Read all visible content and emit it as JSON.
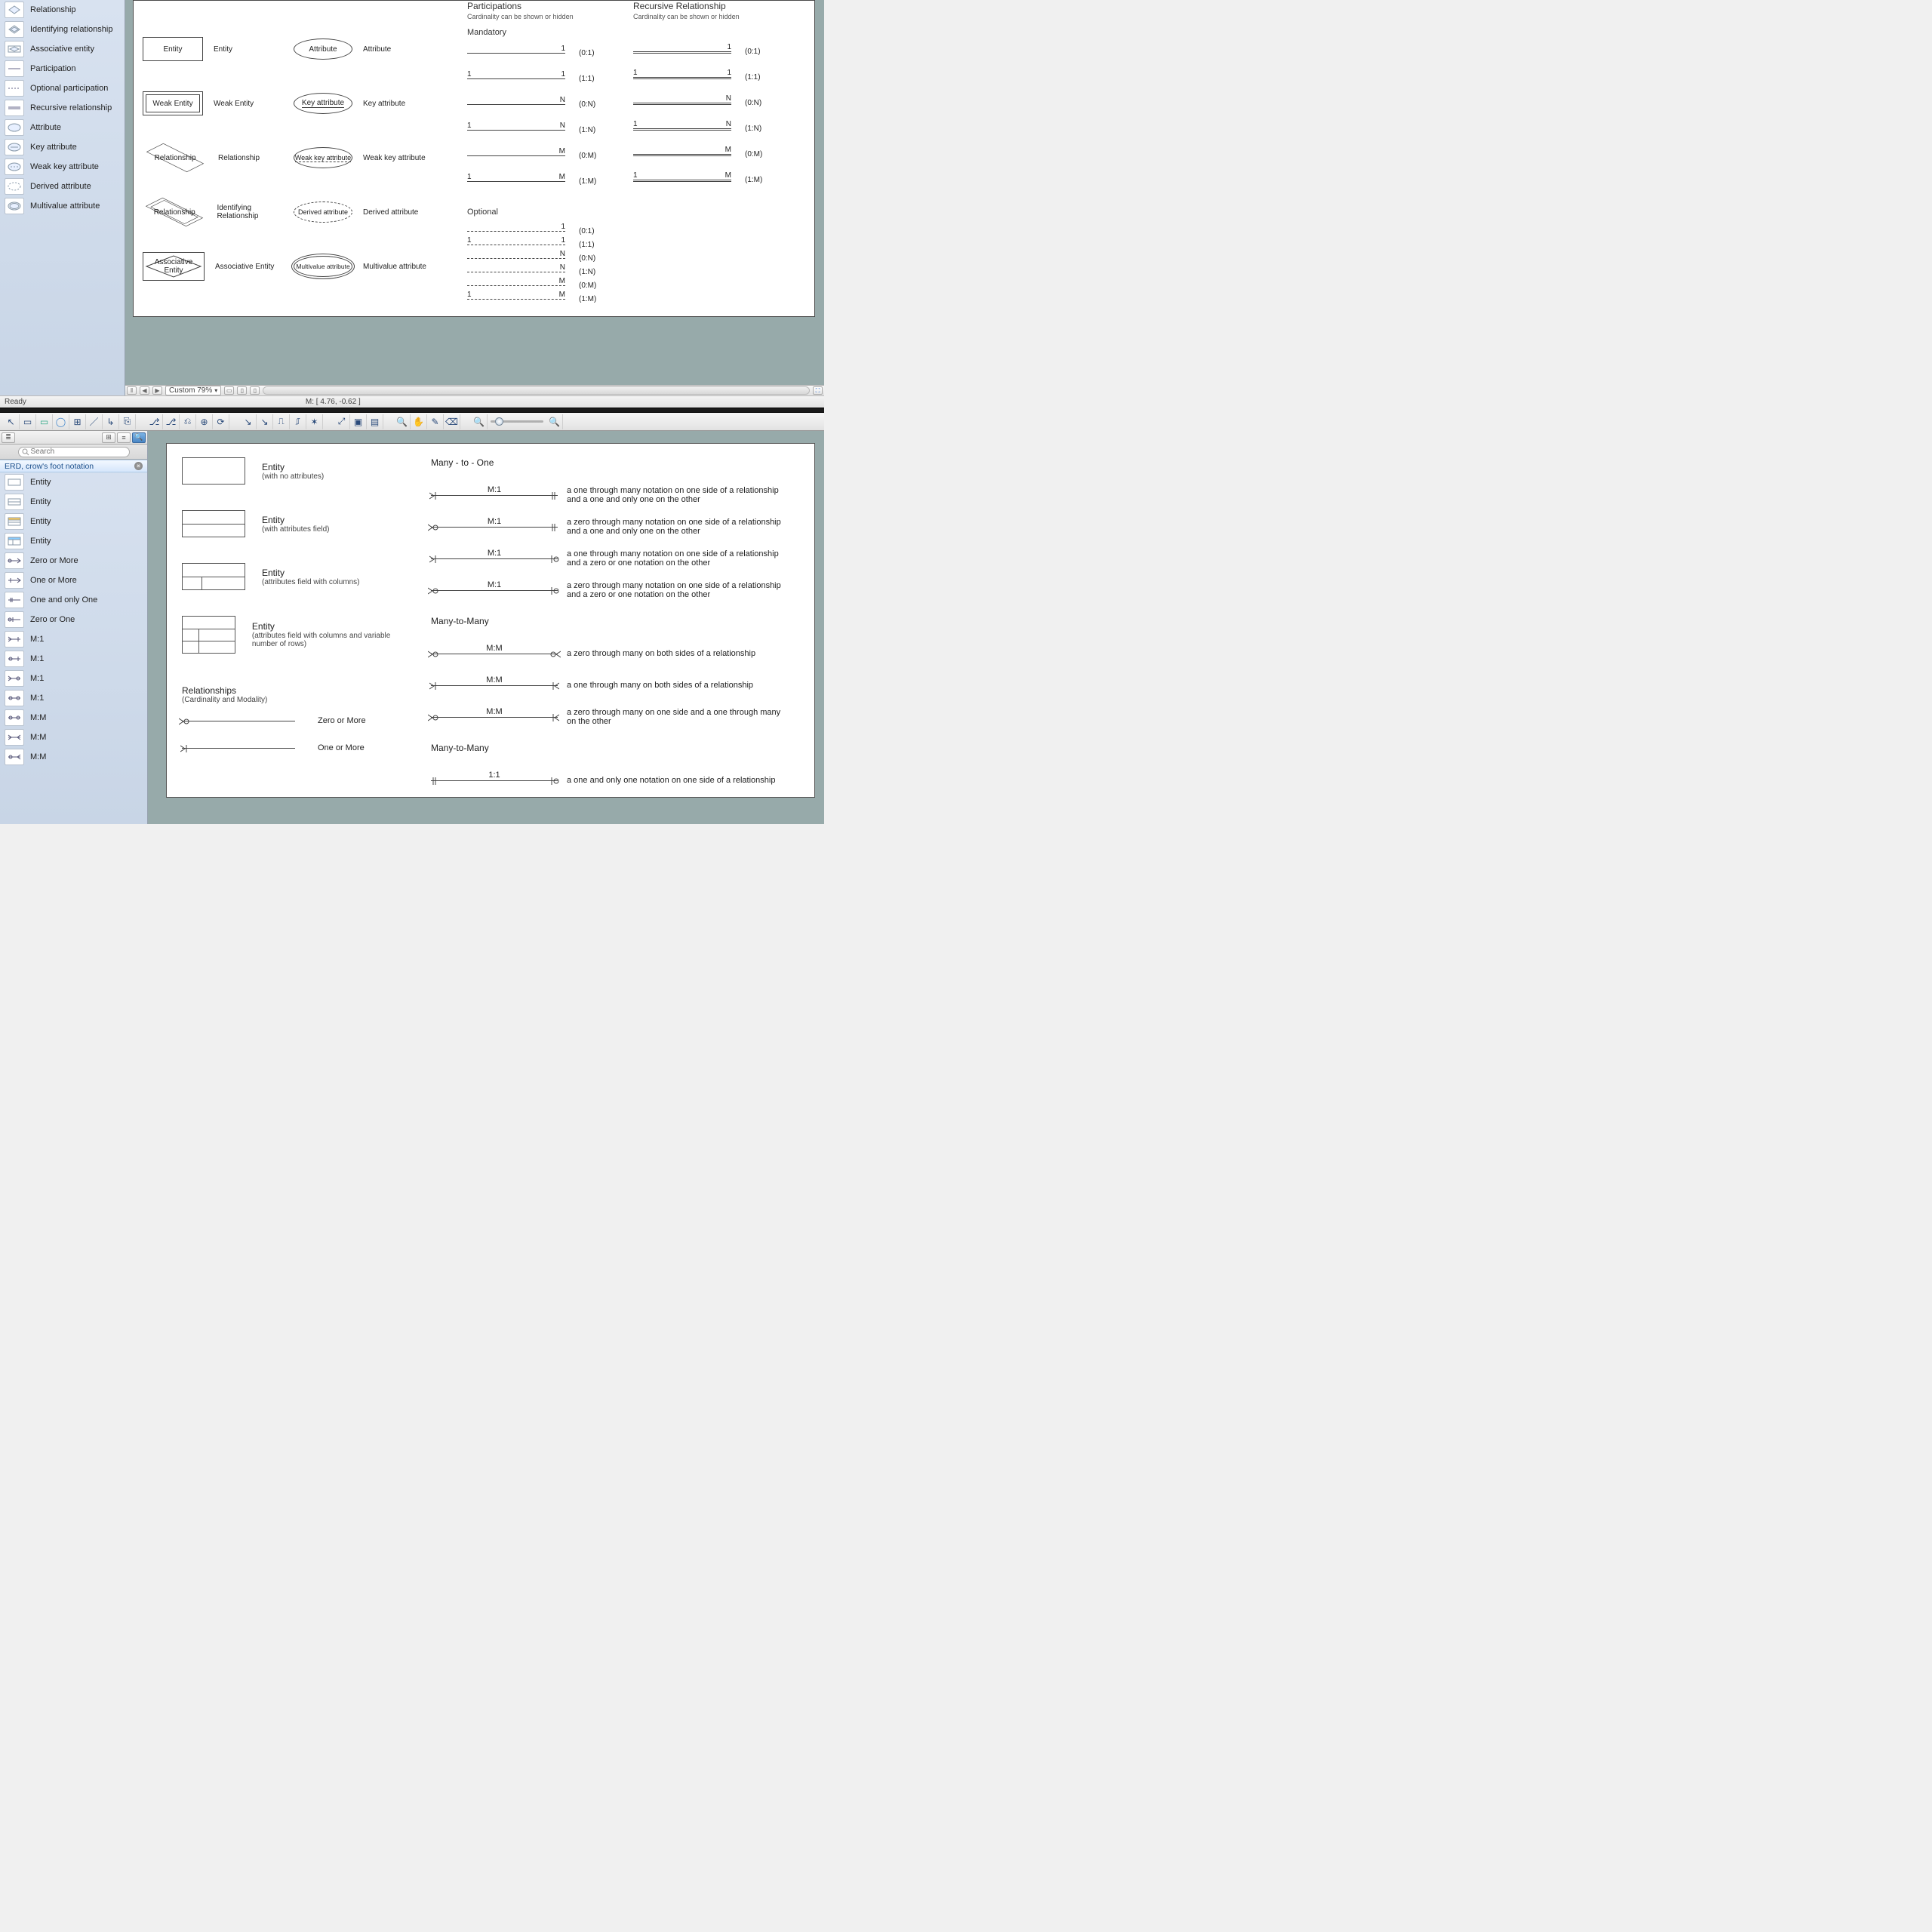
{
  "status": {
    "ready": "Ready",
    "mouse": "M: [ 4.76, -0.62 ]",
    "zoom": "Custom 79%"
  },
  "search_placeholder": "Search",
  "lib_chen": [
    {
      "label": "Relationship"
    },
    {
      "label": "Identifying relationship"
    },
    {
      "label": "Associative entity"
    },
    {
      "label": "Participation"
    },
    {
      "label": "Optional participation"
    },
    {
      "label": "Recursive relationship"
    },
    {
      "label": "Attribute"
    },
    {
      "label": "Key attribute"
    },
    {
      "label": "Weak key attribute"
    },
    {
      "label": "Derived attribute"
    },
    {
      "label": "Multivalue attribute"
    }
  ],
  "chen_canvas": {
    "col1": [
      {
        "shape_label": "Entity",
        "type": "rect",
        "desc": "Entity"
      },
      {
        "shape_label": "Weak Entity",
        "type": "rect-double",
        "desc": "Weak Entity"
      },
      {
        "shape_label": "Relationship",
        "type": "diamond",
        "desc": "Relationship"
      },
      {
        "shape_label": "Relationship",
        "type": "diamond-double",
        "desc": "Identifying Relationship"
      },
      {
        "shape_label": "Associative\nEntity",
        "type": "assoc",
        "desc": "Associative Entity"
      }
    ],
    "col2": [
      {
        "shape_label": "Attribute",
        "type": "oval",
        "desc": "Attribute"
      },
      {
        "shape_label": "Key attribute",
        "type": "oval-under",
        "desc": "Key attribute"
      },
      {
        "shape_label": "Weak key attribute",
        "type": "oval-dash-under",
        "desc": "Weak key attribute"
      },
      {
        "shape_label": "Derived attribute",
        "type": "oval-dashed",
        "desc": "Derived attribute"
      },
      {
        "shape_label": "Multivalue attribute",
        "type": "oval-double",
        "desc": "Multivalue attribute"
      }
    ],
    "part_title": "Participations",
    "part_sub": "Cardinality can be shown or hidden",
    "rec_title": "Recursive Relationship",
    "rec_sub": "Cardinality can be shown or hidden",
    "mand_title": "Mandatory",
    "opt_title": "Optional",
    "mand": [
      {
        "l": "",
        "r": "1",
        "ratio": "(0:1)"
      },
      {
        "l": "1",
        "r": "1",
        "ratio": "(1:1)"
      },
      {
        "l": "",
        "r": "N",
        "ratio": "(0:N)"
      },
      {
        "l": "1",
        "r": "N",
        "ratio": "(1:N)"
      },
      {
        "l": "",
        "r": "M",
        "ratio": "(0:M)"
      },
      {
        "l": "1",
        "r": "M",
        "ratio": "(1:M)"
      }
    ],
    "rec": [
      {
        "l": "",
        "r": "1",
        "ratio": "(0:1)"
      },
      {
        "l": "1",
        "r": "1",
        "ratio": "(1:1)"
      },
      {
        "l": "",
        "r": "N",
        "ratio": "(0:N)"
      },
      {
        "l": "1",
        "r": "N",
        "ratio": "(1:N)"
      },
      {
        "l": "",
        "r": "M",
        "ratio": "(0:M)"
      },
      {
        "l": "1",
        "r": "M",
        "ratio": "(1:M)"
      }
    ],
    "opt": [
      {
        "l": "",
        "r": "1",
        "ratio": "(0:1)"
      },
      {
        "l": "1",
        "r": "1",
        "ratio": "(1:1)"
      },
      {
        "l": "",
        "r": "N",
        "ratio": "(0:N)"
      },
      {
        "l": "",
        "r": "N",
        "ratio": "(1:N)"
      },
      {
        "l": "",
        "r": "M",
        "ratio": "(0:M)"
      },
      {
        "l": "1",
        "r": "M",
        "ratio": "(1:M)"
      }
    ]
  },
  "crow_lib_title": "ERD, crow's foot notation",
  "lib_crow": [
    {
      "label": "Entity"
    },
    {
      "label": "Entity"
    },
    {
      "label": "Entity"
    },
    {
      "label": "Entity"
    },
    {
      "label": "Zero or More"
    },
    {
      "label": "One or More"
    },
    {
      "label": "One and only One"
    },
    {
      "label": "Zero or One"
    },
    {
      "label": "M:1"
    },
    {
      "label": "M:1"
    },
    {
      "label": "M:1"
    },
    {
      "label": "M:1"
    },
    {
      "label": "M:M"
    },
    {
      "label": "M:M"
    },
    {
      "label": "M:M"
    }
  ],
  "crow_canvas": {
    "entities": [
      {
        "name": "Entity",
        "sub": "(with no attributes)",
        "variant": "plain"
      },
      {
        "name": "Entity",
        "sub": "(with attributes field)",
        "variant": "split"
      },
      {
        "name": "Entity",
        "sub": "(attributes field with columns)",
        "variant": "cols"
      },
      {
        "name": "Entity",
        "sub": "(attributes field with columns and variable number of rows)",
        "variant": "rows"
      }
    ],
    "rel_title": "Relationships",
    "rel_sub": "(Cardinality and Modality)",
    "rel_list": [
      {
        "label": "Zero or More",
        "end": "zero-many"
      },
      {
        "label": "One or More",
        "end": "one-many"
      }
    ],
    "sections": [
      {
        "title": "Many - to - One",
        "rows": [
          {
            "tag": "M:1",
            "desc": "a one through many notation on one side of a relationship and a one and only one on the other"
          },
          {
            "tag": "M:1",
            "desc": "a zero through many notation on one side of a relationship and a one and only one on the other"
          },
          {
            "tag": "M:1",
            "desc": "a one through many notation on one side of a relationship and a zero or one notation on the other"
          },
          {
            "tag": "M:1",
            "desc": "a zero through many notation on one side of a relationship and a zero or one notation on the other"
          }
        ]
      },
      {
        "title": "Many-to-Many",
        "rows": [
          {
            "tag": "M:M",
            "desc": "a zero through many on both sides of a relationship"
          },
          {
            "tag": "M:M",
            "desc": "a one through many on both sides of a relationship"
          },
          {
            "tag": "M:M",
            "desc": "a zero through many on one side and a one through many on the other"
          }
        ]
      },
      {
        "title": "Many-to-Many",
        "rows": [
          {
            "tag": "1:1",
            "desc": "a one and only one notation on one side of a relationship"
          }
        ]
      }
    ]
  }
}
